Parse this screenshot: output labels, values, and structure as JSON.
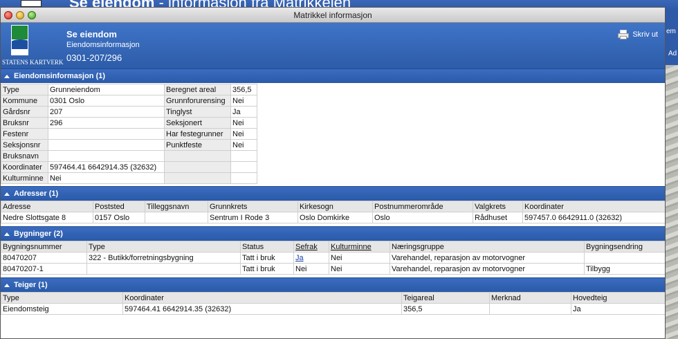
{
  "background": {
    "title_bold": "Se eiendom",
    "title_rest": " - informasjon fra Matrikkelen",
    "right_text_1": "em",
    "right_text_2": "Ad"
  },
  "window": {
    "title": "Matrikkel informasjon"
  },
  "header": {
    "logo_text": "STATENS KARTVERK",
    "title": "Se eiendom",
    "subtitle": "Eiendomsinformasjon",
    "id": "0301-207/296",
    "print_label": "Skriv ut"
  },
  "eiendom": {
    "heading": "Eiendomsinformasjon (1)",
    "rows": [
      {
        "l1": "Type",
        "v1": "Grunneiendom",
        "l2": "Beregnet areal",
        "v2": "356,5"
      },
      {
        "l1": "Kommune",
        "v1": "0301 Oslo",
        "l2": "Grunnforurensing",
        "v2": "Nei"
      },
      {
        "l1": "Gårdsnr",
        "v1": "207",
        "l2": "Tinglyst",
        "v2": "Ja"
      },
      {
        "l1": "Bruksnr",
        "v1": "296",
        "l2": "Seksjonert",
        "v2": "Nei"
      },
      {
        "l1": "Festenr",
        "v1": "",
        "l2": "Har festegrunner",
        "v2": "Nei"
      },
      {
        "l1": "Seksjonsnr",
        "v1": "",
        "l2": "Punktfeste",
        "v2": "Nei"
      },
      {
        "l1": "Bruksnavn",
        "v1": "",
        "l2": "",
        "v2": ""
      },
      {
        "l1": "Koordinater",
        "v1": "597464.41 6642914.35 (32632)",
        "l2": "",
        "v2": ""
      },
      {
        "l1": "Kulturminne",
        "v1": "Nei",
        "l2": "",
        "v2": ""
      }
    ]
  },
  "adresser": {
    "heading": "Adresser (1)",
    "headers": [
      "Adresse",
      "Poststed",
      "Tilleggsnavn",
      "Grunnkrets",
      "Kirkesogn",
      "Postnummerområde",
      "Valgkrets",
      "Koordinater"
    ],
    "rows": [
      [
        "Nedre Slottsgate 8",
        "0157 Oslo",
        "",
        "Sentrum I Rode 3",
        "Oslo Domkirke",
        "Oslo",
        "Rådhuset",
        "597457.0 6642911.0 (32632)"
      ]
    ]
  },
  "bygninger": {
    "heading": "Bygninger (2)",
    "headers": [
      "Bygningsnummer",
      "Type",
      "Status",
      "Sefrak",
      "Kulturminne",
      "Næringsgruppe",
      "Bygningsendring"
    ],
    "rows": [
      [
        "80470207",
        "322 - Butikk/forretningsbygning",
        "Tatt i bruk",
        "Ja",
        "Nei",
        "Varehandel, reparasjon av motorvogner",
        ""
      ],
      [
        "80470207-1",
        "",
        "Tatt i bruk",
        "Nei",
        "Nei",
        "Varehandel, reparasjon av motorvogner",
        "Tilbygg"
      ]
    ]
  },
  "teiger": {
    "heading": "Teiger (1)",
    "headers": [
      "Type",
      "Koordinater",
      "Teigareal",
      "Merknad",
      "Hovedteig"
    ],
    "rows": [
      [
        "Eiendomsteig",
        "597464.41 6642914.35 (32632)",
        "356,5",
        "",
        "Ja"
      ]
    ]
  }
}
